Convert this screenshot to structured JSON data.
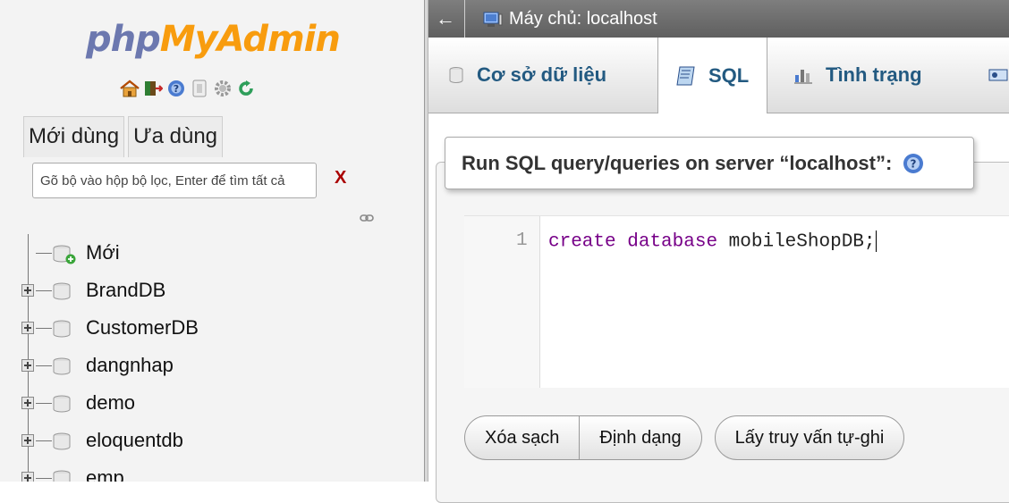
{
  "left_panel": {
    "logo": {
      "part1": "php",
      "part2": "MyAdmin"
    },
    "nav_icons": [
      "home-icon",
      "exit-icon",
      "help-icon",
      "docs-icon",
      "settings-icon",
      "reload-icon"
    ],
    "tabs": {
      "recent": "Mới dùng",
      "favorites": "Ưa dùng"
    },
    "filter": {
      "placeholder": "Gõ bộ vào hộp bộ lọc, Enter để tìm tất cả",
      "clear": "X"
    },
    "tree": {
      "new_label": "Mới",
      "databases": [
        "BrandDB",
        "CustomerDB",
        "dangnhap",
        "demo",
        "eloquentdb",
        "emp"
      ]
    }
  },
  "server_bar": {
    "back": "←",
    "label": "Máy chủ: localhost"
  },
  "tabs": {
    "databases": "Cơ sở dữ liệu",
    "sql": "SQL",
    "status": "Tình trạng"
  },
  "sql_panel": {
    "title": "Run SQL query/queries on server “localhost”:",
    "editor": {
      "line_number": "1",
      "keyword1": "create",
      "keyword2": "database",
      "identifier": "mobileShopDB;"
    },
    "buttons": {
      "clear": "Xóa sạch",
      "format": "Định dạng",
      "auto_save": "Lấy truy vấn tự-ghi"
    }
  },
  "colors": {
    "logo_php": "#6c78af",
    "logo_myadmin": "#f89c0e",
    "tab_text": "#235a81",
    "sql_keyword": "#770088"
  }
}
